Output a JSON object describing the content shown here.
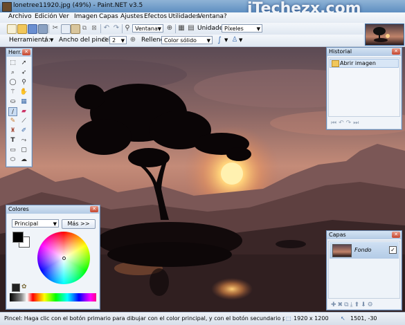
{
  "window": {
    "title": "lonetree11920.jpg (49%) - Paint.NET v3.5",
    "watermark": "iTechezx.com"
  },
  "menu": [
    "Archivo",
    "Edición",
    "Ver",
    "Imagen",
    "Capas",
    "Ajustes",
    "Efectos",
    "Utilidades",
    "Ventana",
    "?"
  ],
  "toolbar": {
    "view_mode": "Ventana",
    "units_label": "Unidades:",
    "units_value": "Píxeles",
    "tool_label": "Herramienta:",
    "brush_width_label": "Ancho del pincel:",
    "brush_width_value": "2",
    "fill_label": "Relleno:",
    "fill_value": "Color sólido"
  },
  "panels": {
    "tools": {
      "title": "Herr..."
    },
    "history": {
      "title": "Historial",
      "items": [
        "Abrir imagen"
      ]
    },
    "colors": {
      "title": "Colores",
      "mode": "Principal",
      "more_button": "Más >>"
    },
    "layers": {
      "title": "Capas",
      "layer_name": "Fondo",
      "layer_visible": true
    }
  },
  "statusbar": {
    "hint": "Pincel: Haga clic con el botón primario para dibujar con el color principal, y con el botón secundario para dibujar con el segur",
    "image_size": "1920 x 1200",
    "cursor": "1501, -30"
  },
  "colors": {
    "accent": "#5e8fc1",
    "primary_color": "#000000",
    "secondary_color": "#ffffff"
  }
}
